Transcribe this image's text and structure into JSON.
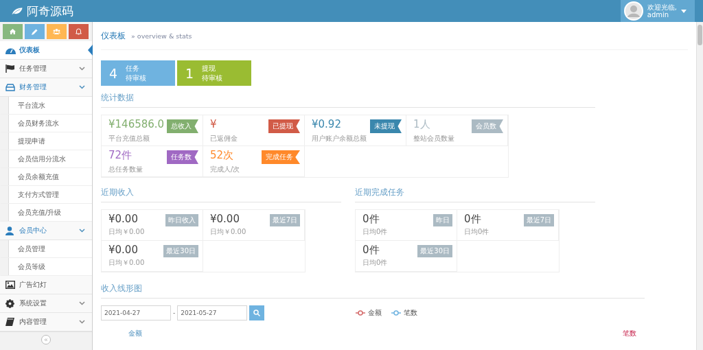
{
  "header": {
    "brand": "阿奇源码",
    "greeting": "欢迎光临,",
    "user": "admin"
  },
  "shortcuts": [
    {
      "kind": "home",
      "color": "#87b87f"
    },
    {
      "kind": "pencil",
      "color": "#6fb3e0"
    },
    {
      "kind": "users",
      "color": "#ffb752"
    },
    {
      "kind": "bell",
      "color": "#d15b47"
    }
  ],
  "sidebar": {
    "items": [
      {
        "label": "仪表板",
        "kind": "dashboard",
        "selected": true
      },
      {
        "label": "任务管理",
        "kind": "flag",
        "selected": false,
        "expanded": false
      },
      {
        "label": "财务管理",
        "kind": "tray",
        "selected": false,
        "expanded": true,
        "children": [
          {
            "label": "平台流水"
          },
          {
            "label": "会员财务流水"
          },
          {
            "label": "提现申请"
          },
          {
            "label": "会员信用分流水"
          },
          {
            "label": "会员余额充值"
          },
          {
            "label": "支付方式管理"
          },
          {
            "label": "会员充值/升级"
          }
        ]
      },
      {
        "label": "会员中心",
        "kind": "user",
        "selected": false,
        "expanded": true,
        "children": [
          {
            "label": "会员管理"
          },
          {
            "label": "会员等级"
          }
        ]
      },
      {
        "label": "广告幻灯",
        "kind": "image",
        "selected": false
      },
      {
        "label": "系统设置",
        "kind": "gear",
        "selected": false,
        "expanded": false
      },
      {
        "label": "内容管理",
        "kind": "book",
        "selected": false,
        "expanded": false
      }
    ],
    "collapse": "«"
  },
  "breadcrumb": {
    "title": "仪表板",
    "subtitle": "» overview & stats"
  },
  "pending": [
    {
      "count": "4",
      "line1": "任务",
      "line2": "待审核",
      "color": "#6fb3e0"
    },
    {
      "count": "1",
      "line1": "提现",
      "line2": "待审核",
      "color": "#9abc32"
    }
  ],
  "stats": {
    "title": "统计数据",
    "cards": [
      {
        "value": "¥146586.0",
        "caption": "平台充值总额",
        "tag": "总收入",
        "color": "#82af6f"
      },
      {
        "value": "¥",
        "caption": "已返佣金",
        "tag": "已提现",
        "color": "#d15b47"
      },
      {
        "value": "¥0.92",
        "caption": "用户账户余额总额",
        "tag": "未提现",
        "color": "#3a87ad"
      },
      {
        "value": "1人",
        "caption": "整站会员数量",
        "tag": "会员数",
        "color": "#abbac3"
      },
      {
        "value": "72件",
        "caption": "总任务数量",
        "tag": "任务数",
        "color": "#a069c3"
      },
      {
        "value": "52次",
        "caption": "完成人/次",
        "tag": "完成任务",
        "color": "#ff892a"
      }
    ]
  },
  "income": {
    "title": "近期收入",
    "cards": [
      {
        "value": "¥0.00",
        "caption": "日均￥0.00",
        "tag": "昨日收入"
      },
      {
        "value": "¥0.00",
        "caption": "日均￥0.00",
        "tag": "最近7日"
      },
      {
        "value": "¥0.00",
        "caption": "日均￥0.00",
        "tag": "最近30日"
      }
    ]
  },
  "tasks": {
    "title": "近期完成任务",
    "cards": [
      {
        "value": "0件",
        "caption": "日均0件",
        "tag": "昨日"
      },
      {
        "value": "0件",
        "caption": "日均0件",
        "tag": "最近7日"
      },
      {
        "value": "0件",
        "caption": "日均0件",
        "tag": "最近30日"
      }
    ]
  },
  "chart": {
    "title": "收入线形图",
    "date_from": "2021-04-27",
    "separator": "-",
    "date_to": "2021-05-27",
    "legend": [
      {
        "label": "金额",
        "color": "#d46a6a"
      },
      {
        "label": "笔数",
        "color": "#6fb3e0"
      }
    ],
    "left_axis": "金额",
    "right_axis": "笔数"
  }
}
